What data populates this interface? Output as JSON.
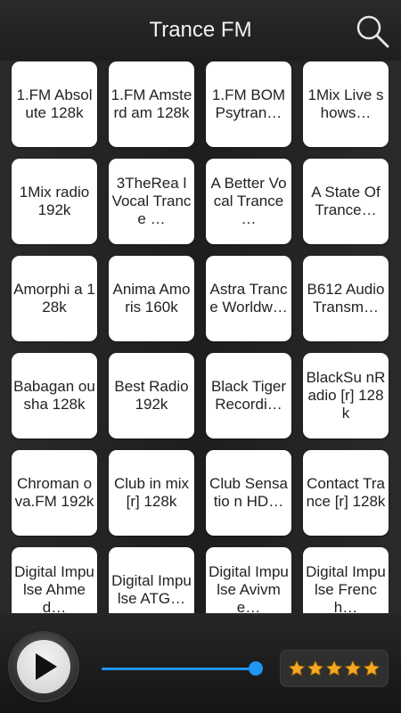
{
  "header": {
    "title": "Trance FM"
  },
  "stations": [
    "1.FM Absolute 128k",
    "1.FM Amsterd am 128k",
    "1.FM BOM Psytran…",
    "1Mix Live shows…",
    "1Mix radio 192k",
    "3TheRea l Vocal Trance …",
    "A Better Vocal Trance …",
    "A State Of Trance…",
    "Amorphi a 128k",
    "Anima Amoris 160k",
    "Astra Trance Worldw…",
    "B612 Audio Transm…",
    "Babagan ousha 128k",
    "Best Radio 192k",
    "Black Tiger Recordi…",
    "BlackSu nRadio [r] 128k",
    "Chroman ova.FM 192k",
    "Club in mix [r] 128k",
    "Club Sensatio n HD…",
    "Contact Trance [r] 128k",
    "Digital Impulse Ahmed…",
    "Digital Impulse ATG…",
    "Digital Impulse Avivme…",
    "Digital Impulse French…"
  ],
  "player": {
    "volume": 1.0,
    "rating_stars": 5
  },
  "colors": {
    "accent": "#2196f3",
    "star": "#f5a623"
  }
}
